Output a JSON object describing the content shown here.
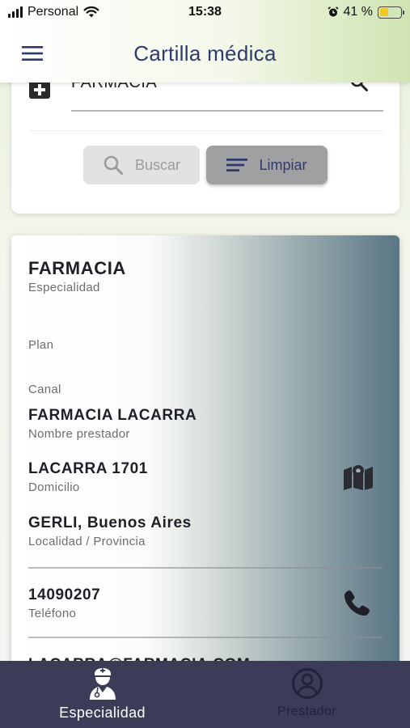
{
  "status_bar": {
    "carrier": "Personal",
    "time": "15:38",
    "battery": "41 %",
    "battery_level": 0.41
  },
  "header": {
    "title": "Cartilla médica",
    "menu_icon": "hamburger-menu-icon"
  },
  "search": {
    "category_icon": "medical-cross-icon",
    "query": "FARMACIA",
    "search_icon": "magnifier-icon",
    "buttons": {
      "search_label": "Buscar",
      "clear_label": "Limpiar"
    }
  },
  "result": {
    "specialty_value": "FARMACIA",
    "specialty_label": "Especialidad",
    "plan_label": "Plan",
    "channel_label": "Canal",
    "provider_value": "FARMACIA LACARRA",
    "provider_label": "Nombre prestador",
    "address_value": "LACARRA 1701",
    "address_label": "Domicilio",
    "location_value": "GERLI, Buenos Aires",
    "location_label": "Localidad / Provincia",
    "phone_value": "14090207",
    "phone_label": "Teléfono",
    "email_value": "LACARRA@FARMACIA.COM",
    "map_icon": "map-icon",
    "phone_icon": "phone-icon"
  },
  "bottom_nav": {
    "items": [
      {
        "label": "Especialidad",
        "icon": "doctor-icon",
        "active": true
      },
      {
        "label": "Prestador",
        "icon": "user-circle-icon",
        "active": false
      }
    ]
  },
  "colors": {
    "primary": "#2f3a6c",
    "nav_background": "#3c3b58",
    "battery": "#f2c824"
  }
}
